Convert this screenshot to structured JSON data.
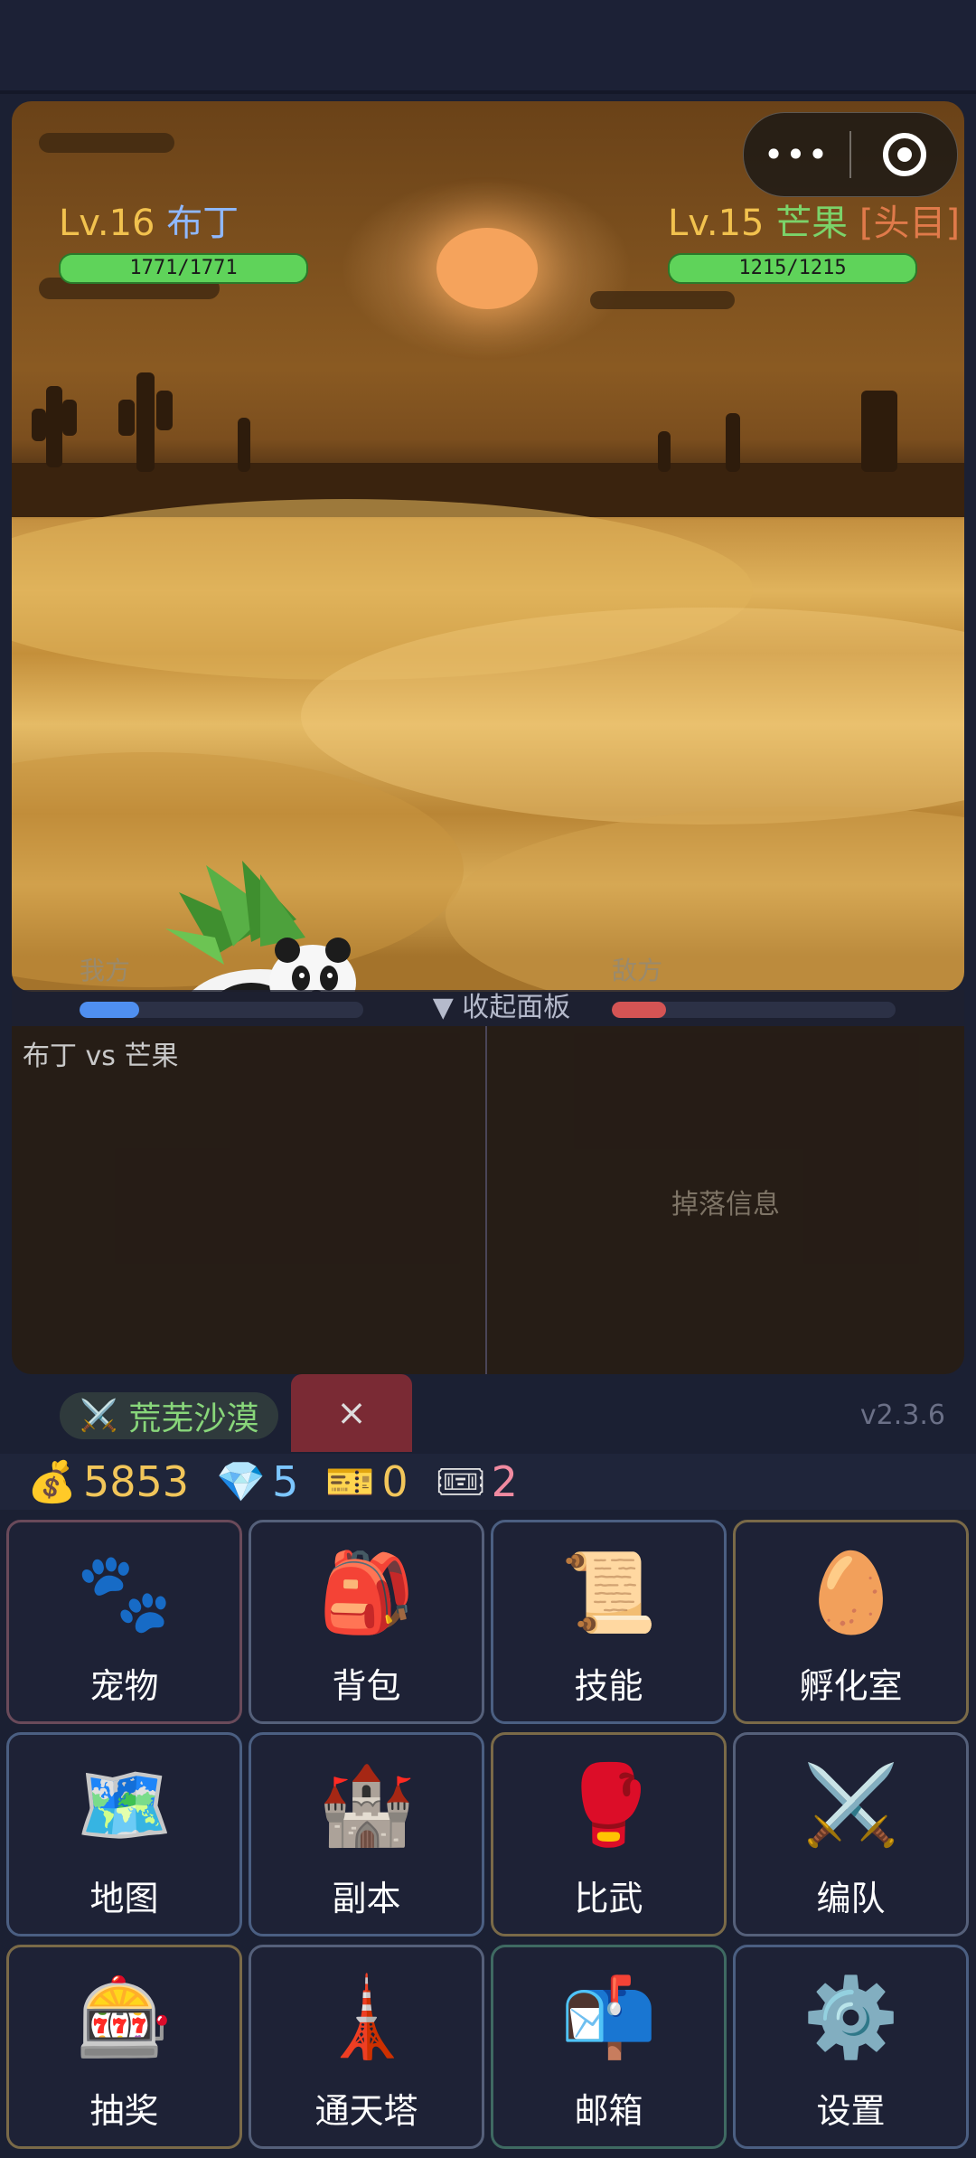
{
  "battle": {
    "player": {
      "level": "Lv.16",
      "name": "布丁",
      "hp_text": "1771/1771",
      "hp_ratio": 1.0
    },
    "enemy": {
      "level": "Lv.15",
      "name": "芒果",
      "tag": "[头目]",
      "hp_text": "1215/1215",
      "hp_ratio": 1.0
    },
    "mini_program": {
      "more_label": "•••"
    },
    "strip": {
      "ally_label": "我方",
      "enemy_label": "敌方",
      "collapse_label": "▼ 收起面板",
      "ally_bar": 0.21,
      "enemy_bar": 0.19,
      "ally_color": "#4f8ff0",
      "enemy_color": "#d45454"
    },
    "log_left": "布丁 vs 芒果",
    "log_right": "掉落信息"
  },
  "location": {
    "icon": "⚔️",
    "name": "荒芜沙漠",
    "close_label": "×",
    "version": "v2.3.6"
  },
  "currency": [
    {
      "icon": "💰",
      "value": "5853",
      "color": "#f2c65a"
    },
    {
      "icon": "💎",
      "value": "5",
      "color": "#7cc6ff"
    },
    {
      "icon": "🎫",
      "value": "0",
      "color": "#f2c65a"
    },
    {
      "icon": "🎟",
      "value": "2",
      "color": "#f08aa0"
    }
  ],
  "menu": [
    {
      "label": "宠物",
      "icon": "🐾",
      "border": "#6a4a5a"
    },
    {
      "label": "背包",
      "icon": "🎒",
      "border": "#55607a"
    },
    {
      "label": "技能",
      "icon": "📜",
      "border": "#4b5f82"
    },
    {
      "label": "孵化室",
      "icon": "🥚",
      "border": "#7a6a48"
    },
    {
      "label": "地图",
      "icon": "🗺️",
      "border": "#4b5f82"
    },
    {
      "label": "副本",
      "icon": "🏰",
      "border": "#4b5f82"
    },
    {
      "label": "比武",
      "icon": "🥊",
      "border": "#7a6a48"
    },
    {
      "label": "编队",
      "icon": "⚔️",
      "border": "#55607a"
    },
    {
      "label": "抽奖",
      "icon": "🎰",
      "border": "#7a6a48"
    },
    {
      "label": "通天塔",
      "icon": "🗼",
      "border": "#55607a"
    },
    {
      "label": "邮箱",
      "icon": "📬",
      "border": "#3f6a62"
    },
    {
      "label": "设置",
      "icon": "⚙️",
      "border": "#4b5f82"
    }
  ]
}
